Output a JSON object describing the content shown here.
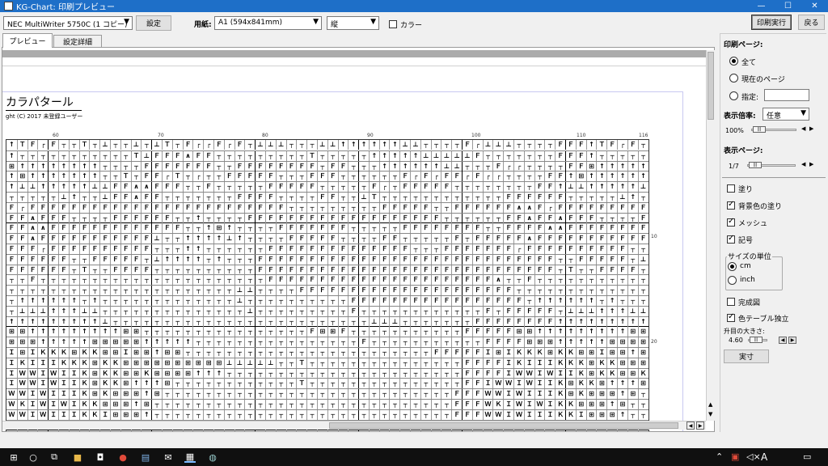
{
  "window": {
    "title": "KG-Chart: 印刷プレビュー",
    "min": "—",
    "max": "☐",
    "close": "✕"
  },
  "toolbar": {
    "printer": "NEC MultiWriter 5750C (1 コピー)",
    "settings_btn": "設定",
    "paper_label": "用紙:",
    "paper": "A1 (594x841mm)",
    "orientation": "縦",
    "color_label": "カラー",
    "print_btn": "印刷実行",
    "back_btn": "戻る"
  },
  "tabs": [
    {
      "label": "プレビュー"
    },
    {
      "label": "設定詳細"
    }
  ],
  "preview": {
    "title": "カラパタール",
    "copyright": "ght (C) 2017 未登録ユーザー",
    "ruler": [
      "60",
      "70",
      "80",
      "90",
      "100",
      "110",
      "116"
    ],
    "side_numbers": [
      "10",
      "20"
    ],
    "rows": [
      "↑ＴＦ┌Ｆ┬┬Ｔ┬⊥┬┬⊥┬⊥Ｔ┬Ｆ┌┌Ｆ┌Ｆ┬⊥⊥⊥┬┬┬⊥⊥↑↑↑↑↑↑⊥⊥┬┬┬┬Ｆ┌⊥⊥⊥┬┬┬┬ＦＦＦ",
      "↑┬┬┬┬┬┬┬┬┬┬┬Ｔ⊥ＦＦＦ∧ＦＦ┬┬┬┬┬┬┬┬┬Ｔ┬┬┬┬┬↑↑↑↑↑⊥⊥⊥⊥⊥Ｆ┬┬┬┬┬┬┬ＦＦＦ",
      "⊞↑↑↑↑↑↑↑↑┬┬┬┬ＦＦＦＦＦＦＦ┬┬ＦＦＦＦＦＦＦＦ┬ＦＦ┬┬┬↑↑↑↑↑↑⊥⊥┬┬┬Ｆ┌┌┬┬┬┬ＦＦ",
      "↑⊞↑↑↑↑↑↑↑┬┬Ｔ┬ＦＦ┌Ｔ┬┌┬┬ＦＦＦＦＦ┬┬┬ＦＦＦ┬┬┬┬┬┬Ｆ┌Ｆ┌ＦＦ┌Ｆ┌┌┬┬┬┬ＦＦ",
      "↑⊥⊥↑↑↑↑↑⊥⊥ＦＦ∧∧ＦＦＦ┬┬Ｆ┬┬┬┬┬ＦＦＦＦＦ┬┬┬┬┬Ｆ┌┬ＦＦＦＦＦ┬┬┬┬┬┬┬┬ＦＦ",
      "┬┬┬┬┬⊥↑┬┬⊥ＦＦ∧ＦＦ┬┬┬┬┬┬┬ＦＦＦＦ┬┬┬┬ＦＦ┬┬⊥Ｔ┬┬┬┬┬┬┬┬┬┬┬┬ＦＦＦＦＦＦ",
      "Ｆ┌ＦＦＦＦＦＦＦＦＦＦＦＦＦＦＦＦＦＦＦＦＦＦＦＦＦ┬┬┬┬┬┬┬┬┬ＦＦＦＦＦ┬┬ＦＦＦＦＦＦ∧∧",
      "ＦＦ∧ＦＦＦ┬┬┬┬ＦＦＦＦＦＦ┬┬↑┬┬┬┬ＦＦＦＦＦＦＦＦＦＦＦＦＦＦＦＦＦＦＦ┬┬┬┬┬┬ＦＦ∧",
      "ＦＦ∧∧ＦＦＦＦＦＦＦＦＦＦＦＦＦ┬┬↑⊞↑┬┬┬┬ＦＦＦＦＦＦＦ┬┬┬┬┬ＦＦＦＦＦＦＦＦ┬┬ＦＦ",
      "ＦＦ∧ＦＦＦＦＦＦＦＦＦＦＦ⊥┬┬↑↑↑↑⊥↑┬┬┬┬ＦＦＦＦＦ┬┬┬┬ＦＦ┬┬┬┬┬Ｆ┬ＦＦＦ",
      "ＦＦＦ┌ＦＦＦＦＦＦＦＦＦＦ┬┬┬↑↑┬┬┬┬┬┬ＦＦＦＦＦＦＦＦＦＦＦＦＦＦ┬┬┬ＦＦＦＦ",
      "ＦＦＦＦＦＦ┬┬ＦＦＦＦＦ┬⊥↑↑↑↑┬↑┬┬┬ＦＦＦＦＦＦＦＦＦＦＦＦＦＦＦＦＦＦＦＦＦＦＦ",
      "ＦＦＦＦＦＦ┬Ｔ┬┬ＦＦＦＦ┬┬┬┬┬┬┬┬┬┬ＦＦＦＦＦＦＦＦＦＦＦＦＦＦＦＦＦＦＦＦＦＦＦ",
      "┬┬Ｆ┬┬┬┬┬┬┬┬┬┬┬┬┬┬┬┬┬┬┬┬┬┬ＦＦＦＦＦＦＦＦＦＦＦＦＦＦＦＦＦＦＦＦＦＦ∧",
      "┬┬┬┬┬┬┬┬┬┬┬┬┬┬┬┬┬┬┬┬┬┬⊥⊥┬┬┬┬ＦＦＦＦＦＦＦＦＦＦＦＦＦＦＦＦＦＦＦＦＦ",
      "┬↑↑↑↑↑↑┬↑┬┬┬┬┬┬┬┬┬┬┬┬┬⊥┬┬┬┬┬┬┬┬┬┬ＦＦＦＦＦＦＦＦＦＦＦＦＦＦＦＦＦ",
      "┬⊥⊥⊥↑↑↑⊥⊥┬┬┬┬┬┬┬┬┬┬┬┬┬┬⊥┬┬┬┬┬┬┬┬┬Ｆ┬┬┬┬┬┬┬┬┬┬┬┬Ｆ┬ＦＦＦＦＦ",
      "↑↑↑↑↑↑↑↑↑⊥┬┬┬┬┬┬┬┬┬┬┬┬┬┬┬┬┬┬┬┬┬┬┬┬┬⊥⊥⊥┬┬┬┬┬┬┬ＦＦＦＦＦＦＦＦ",
      "⊞⊞↑↑↑↑↑↑↑↑↑⊞⊞┬┬┬┬┬┬┬┬┬┬┬┬┬┬┬┬Ｆ⊞⊞Ｆ┬┬┬┬┬┬┬┬┬┬┬ＦＦＦＦＦ",
      "⊞⊞⊞↑↑↑↑↑⊞⊞⊞⊞⊞↑↑↑↑↑┬┬┬┬┬┬┬┬┬┬┬┬┬┬┬┬Ｆ┬┬┬┬┬┬┬┬┬┬┬ＦＦＦＦ",
      "Ｉ⊞ＩＫＫＫ⊞ＫＫ⊞⊞Ｉ⊞⊞↑⊞⊞┬┬┬┬┬┬┬┬┬┬┬┬┬┬┬┬┬┬┬┬┬┬┬┬ＦＦＦＦＦ",
      "ＩＫＩＩＩＫＫＫ⊞ＫＫ⊞⊞⊞⊞⊞⊞⊞⊞⊞⊞⊥⊥⊥⊥⊥┬┬Ｔ┬┬┬┬┬┬┬┬┬┬┬┬┬┬┬ＦＦＦＦ",
      "ＩＷＷＩＷＩＩＫ⊞ＫＫ⊞⊞Ｋ⊞⊞⊞⊞↑↑↑┬┬┬┬┬┬┬┬┬┬┬┬┬┬┬┬┬┬┬┬┬┬┬ＦＦＦＦ",
      "ＩＷＷＩＷＩＩＫ⊞ＫＫ⊞↑↑↑⊞┬┬┬┬┬┬┬┬┬┬┬┬Ｔ┬┬┬┬┬┬┬┬┬┬┬┬┬┬┬ＦＦ",
      "ＷＷＩＷＩＩＩＫ⊞Ｋ⊞⊞⊞↑⊞┬┬┬┬┬┬┬┬┬┬┬┬┬┬┬┬┬┬┬┬┬┬┬┬┬┬┬┬ＦＦＦ",
      "ＷＫＩＷＩＷＩＫＫ⊞⊞⊞↑⊞┬┬┬┬┬┬┬┬┬┬┬┬┬┬┬┬┬┬┬┬┬┬┬┬┬┬┬┬┬ＦＦＦ",
      "ＷＷＩＷＩＩＩＫＫＩ⊞⊞⊞↑┬┬┬┬┬┬┬┬┬┬┬┬┬┬┬┬┬┬┬┬┬┬┬┬┬┬┬┬┬ＦＦＦ",
      "ＩＷＩＩＩＫＫＫＩＩ⊞⊞⊞↑┬┬┬┬┬┬┬┬┬┬┬┬┬┬┬┬┬┬┬┬┬┬┬┬┬┬┬┬┬ＦＦＦ",
      "ＩＷＩＩＩＫＫＩＩ⊞⊞⊞↑┬┬┬┬┬┬┬┬┬┬┬┬┬┬┬┬┬┬┬┬┬┬┬┬┬┬┬┬┬┬ＦＦＦ"
    ]
  },
  "panel": {
    "print_page_label": "印刷ページ:",
    "all": "全て",
    "current": "現在のページ",
    "specify": "指定:",
    "zoom_label": "表示倍率:",
    "zoom_select": "任意",
    "zoom_value": "100%",
    "display_page_label": "表示ページ:",
    "page_value": "1/7",
    "fill": "塗り",
    "bg_fill": "背景色の塗り",
    "mesh": "メッシュ",
    "symbol": "記号",
    "size_unit_label": "サイズの単位",
    "cm": "cm",
    "inch": "inch",
    "complete": "完成図",
    "color_table": "色テーブル独立",
    "cell_size_label": "升目の大きさ:",
    "cell_size_value": "4.60",
    "actual_btn": "実寸"
  },
  "taskbar": {
    "ime": "A",
    "start_icon": "windows-icon"
  },
  "colors": {
    "titlebar": "#1e6fc8",
    "taskbar": "#101010",
    "window_bg": "#f0f0f0"
  }
}
